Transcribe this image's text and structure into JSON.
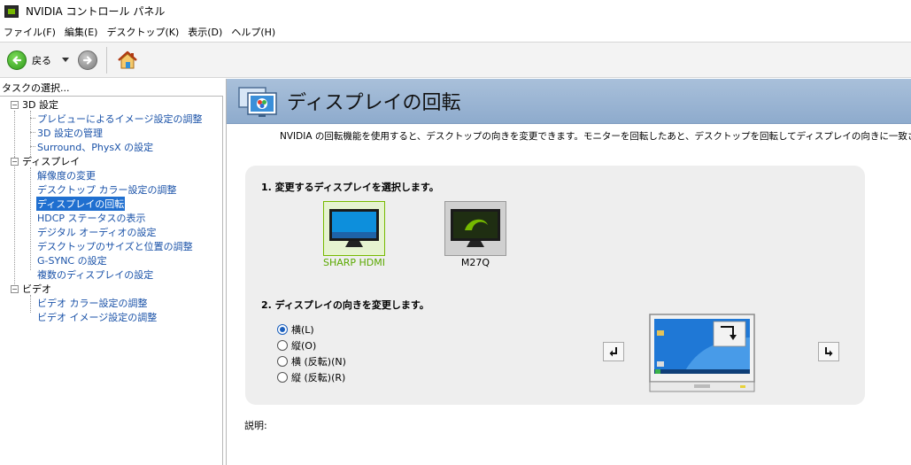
{
  "window": {
    "title": "NVIDIA コントロール パネル"
  },
  "menu": [
    "ファイル(F)",
    "編集(E)",
    "デスクトップ(K)",
    "表示(D)",
    "ヘルプ(H)"
  ],
  "toolbar": {
    "back_label": "戻る",
    "icons": [
      "back-arrow-icon",
      "dropdown-icon",
      "forward-arrow-icon",
      "home-icon"
    ]
  },
  "sidebar": {
    "task_label": "タスクの選択...",
    "categories": [
      {
        "label": "3D 設定",
        "items": [
          "プレビューによるイメージ設定の調整",
          "3D 設定の管理",
          "Surround、PhysX の設定"
        ]
      },
      {
        "label": "ディスプレイ",
        "items": [
          "解像度の変更",
          "デスクトップ カラー設定の調整",
          "ディスプレイの回転",
          "HDCP ステータスの表示",
          "デジタル オーディオの設定",
          "デスクトップのサイズと位置の調整",
          "G-SYNC の設定",
          "複数のディスプレイの設定"
        ]
      },
      {
        "label": "ビデオ",
        "items": [
          "ビデオ カラー設定の調整",
          "ビデオ イメージ設定の調整"
        ]
      }
    ],
    "selected": "ディスプレイの回転"
  },
  "content": {
    "title": "ディスプレイの回転",
    "description": "NVIDIA の回転機能を使用すると、デスクトップの向きを変更できます。モニターを回転したあと、デスクトップを回転してディスプレイの向きに一致させる必要",
    "step1": "1. 変更するディスプレイを選択します。",
    "displays": [
      {
        "name": "SHARP HDMI",
        "selected": true
      },
      {
        "name": "M27Q",
        "selected": false
      }
    ],
    "step2": "2. ディスプレイの向きを変更します。",
    "orientations": [
      {
        "label": "横(L)",
        "checked": true
      },
      {
        "label": "縦(O)",
        "checked": false
      },
      {
        "label": "横 (反転)(N)",
        "checked": false
      },
      {
        "label": "縦 (反転)(R)",
        "checked": false
      }
    ],
    "explain_label": "説明:"
  },
  "colors": {
    "nvidia_green": "#76b900",
    "link_blue": "#1a52a8",
    "selected_blue": "#1f6fd0",
    "header_blue": "#9db7d6"
  }
}
